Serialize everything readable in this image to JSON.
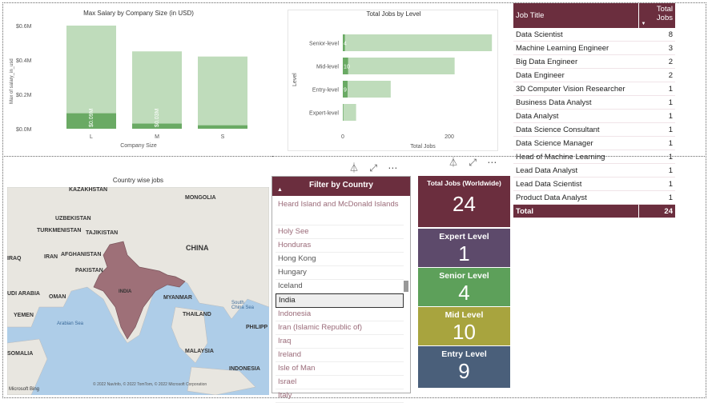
{
  "salary_chart": {
    "title": "Max Salary by Company Size (in USD)",
    "xlabel": "Company Size",
    "ylabel": "Max of salary_in_usd",
    "y_ticks": [
      "$0.6M",
      "$0.4M",
      "$0.2M",
      "$0.0M"
    ],
    "chart_data": {
      "type": "bar",
      "categories": [
        "L",
        "M",
        "S"
      ],
      "series": [
        {
          "values": [
            0.6,
            0.45,
            0.42
          ]
        },
        {
          "values": [
            0.09,
            0.03,
            0.02
          ]
        }
      ],
      "data_labels": [
        "$0.09M",
        "$0.03M",
        ""
      ],
      "ylim": [
        0,
        0.6
      ]
    }
  },
  "level_chart": {
    "title": "Total Jobs by Level",
    "xlabel": "Total Jobs",
    "ylabel": "Level",
    "x_ticks": [
      "0",
      "200"
    ],
    "chart_data": {
      "type": "bar",
      "categories": [
        "Senior-level",
        "Mid-level",
        "Entry-level",
        "Expert-level"
      ],
      "series": [
        {
          "values": [
            280,
            210,
            90,
            25
          ]
        },
        {
          "values": [
            4,
            10,
            9,
            1
          ]
        }
      ],
      "data_labels": [
        "4",
        "10",
        "9",
        ""
      ],
      "xlim": [
        0,
        300
      ]
    }
  },
  "job_table": {
    "headers": [
      "Job Title",
      "Total Jobs"
    ],
    "rows": [
      [
        "Data Scientist",
        "8"
      ],
      [
        "Machine Learning Engineer",
        "3"
      ],
      [
        "Big Data Engineer",
        "2"
      ],
      [
        "Data Engineer",
        "2"
      ],
      [
        "3D Computer Vision Researcher",
        "1"
      ],
      [
        "Business Data Analyst",
        "1"
      ],
      [
        "Data Analyst",
        "1"
      ],
      [
        "Data Science Consultant",
        "1"
      ],
      [
        "Data Science Manager",
        "1"
      ],
      [
        "Head of Machine Learning",
        "1"
      ],
      [
        "Lead Data Analyst",
        "1"
      ],
      [
        "Lead Data Scientist",
        "1"
      ],
      [
        "Product Data Analyst",
        "1"
      ]
    ],
    "total_label": "Total",
    "total_value": "24"
  },
  "map": {
    "title": "Country wise jobs",
    "labels": {
      "kazakhstan": "KAZAKHSTAN",
      "mongolia": "MONGOLIA",
      "uzbekistan": "UZBEKISTAN",
      "turkmenistan": "TURKMENISTAN",
      "tajikistan": "TAJIKISTAN",
      "iraq": "IRAQ",
      "iran": "IRAN",
      "afghanistan": "AFGHANISTAN",
      "china": "CHINA",
      "pakistan": "PAKISTAN",
      "india": "INDIA",
      "saudi": "UDI ARABIA",
      "oman": "OMAN",
      "myanmar": "MYANMAR",
      "south_china_sea": "South China Sea",
      "yemen": "YEMEN",
      "arabian_sea": "Arabian Sea",
      "thailand": "THAILAND",
      "philippines": "PHILIPP",
      "somalia": "SOMALIA",
      "malaysia": "MALAYSIA",
      "indonesia": "INDONESIA",
      "bing": "Microsoft Bing",
      "copyright": "© 2022 NavInfo, © 2022 TomTom, © 2022 Microsoft Corporation"
    },
    "highlight_color": "#9e7078"
  },
  "filter": {
    "title": "Filter by Country",
    "items": [
      "Heard Island and McDonald Islands",
      "Holy See",
      "Honduras",
      "Hong Kong",
      "Hungary",
      "Iceland",
      "India",
      "Indonesia",
      "Iran (Islamic Republic of)",
      "Iraq",
      "Ireland",
      "Isle of Man",
      "Israel",
      "Italy"
    ],
    "selected": "India"
  },
  "kpis": {
    "total": {
      "label": "Total Jobs (Worldwide)",
      "value": "24",
      "color": "#6b2e3e"
    },
    "expert": {
      "label": "Expert Level",
      "value": "1",
      "color": "#5d4a6b"
    },
    "senior": {
      "label": "Senior Level",
      "value": "4",
      "color": "#5da05a"
    },
    "mid": {
      "label": "Mid Level",
      "value": "10",
      "color": "#a8a43e"
    },
    "entry": {
      "label": "Entry Level",
      "value": "9",
      "color": "#4a5f7a"
    }
  },
  "colors": {
    "bar_light": "#bfdcbb",
    "bar_dark": "#6aaa64",
    "header": "#6b2e3e"
  }
}
